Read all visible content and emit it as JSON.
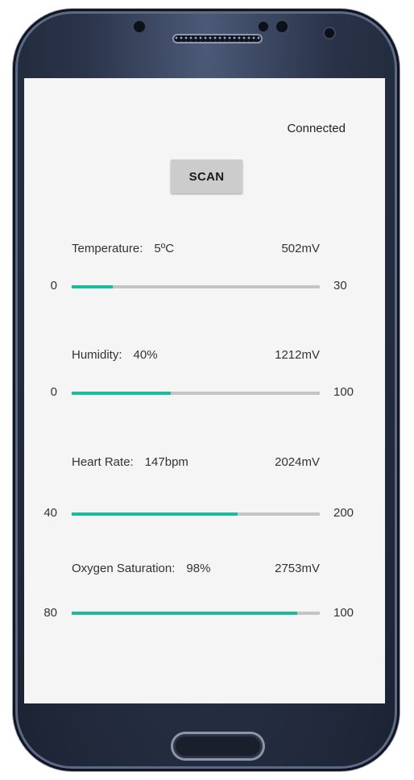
{
  "app": {
    "status": "Connected",
    "scan_label": "SCAN"
  },
  "sensors": [
    {
      "label": "Temperature:",
      "value": "5ºC",
      "mv": "502mV",
      "min": "0",
      "max": "30",
      "fill_fraction": 0.167
    },
    {
      "label": "Humidity:",
      "value": "40%",
      "mv": "1212mV",
      "min": "0",
      "max": "100",
      "fill_fraction": 0.4
    },
    {
      "label": "Heart Rate:",
      "value": "147bpm",
      "mv": "2024mV",
      "min": "40",
      "max": "200",
      "fill_fraction": 0.67
    },
    {
      "label": "Oxygen Saturation:",
      "value": "98%",
      "mv": "2753mV",
      "min": "80",
      "max": "100",
      "fill_fraction": 0.91
    }
  ],
  "colors": {
    "accent": "#1abc9c",
    "track": "#c4c4c4",
    "screen_bg": "#f5f5f5",
    "button_bg": "#cccccc"
  }
}
